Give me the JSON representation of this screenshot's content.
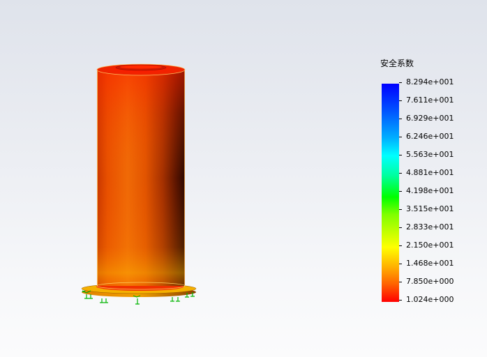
{
  "legend": {
    "title": "安全系数",
    "ticks": [
      "8.294e+001",
      "7.611e+001",
      "6.929e+001",
      "6.246e+001",
      "5.563e+001",
      "4.881e+001",
      "4.198e+001",
      "3.515e+001",
      "2.833e+001",
      "2.150e+001",
      "1.468e+001",
      "7.850e+000",
      "1.024e+000"
    ]
  },
  "colors": {
    "max": "#0000ff",
    "min": "#ff0000",
    "fixture": "#00c800"
  }
}
